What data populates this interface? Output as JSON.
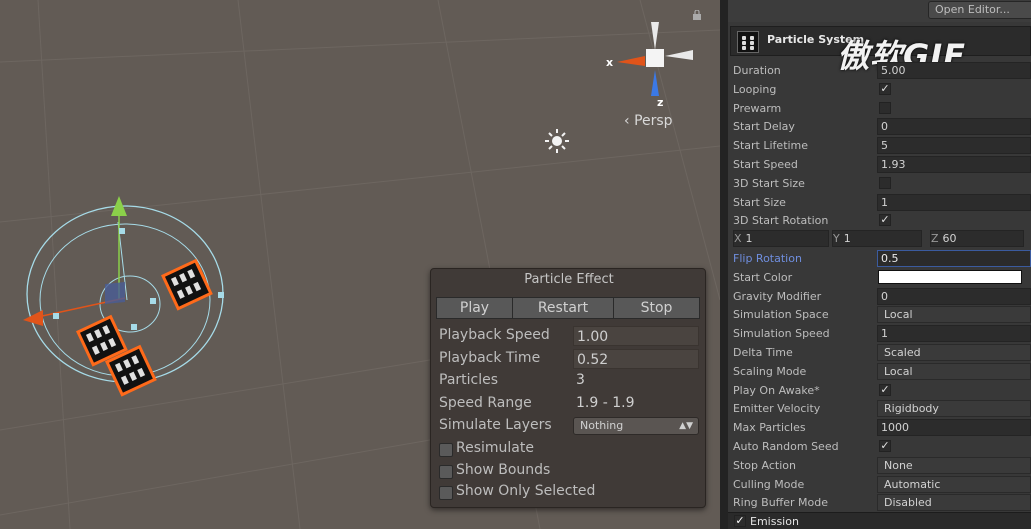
{
  "scene": {
    "gizmo": {
      "x_label": "x",
      "z_label": "z",
      "projection": "Persp"
    },
    "icons": [
      "lock-icon",
      "sun-icon",
      "move-gizmo",
      "particle-sprite"
    ]
  },
  "particle_effect": {
    "title": "Particle Effect",
    "buttons": {
      "play": "Play",
      "restart": "Restart",
      "stop": "Stop"
    },
    "playback_speed": {
      "label": "Playback Speed",
      "value": "1.00"
    },
    "playback_time": {
      "label": "Playback Time",
      "value": "0.52"
    },
    "particles": {
      "label": "Particles",
      "value": "3"
    },
    "speed_range": {
      "label": "Speed Range",
      "value": "1.9 - 1.9"
    },
    "simulate_layers": {
      "label": "Simulate Layers",
      "value": "Nothing"
    },
    "resimulate": "Resimulate",
    "show_bounds": "Show Bounds",
    "show_only_selected": "Show Only Selected"
  },
  "inspector": {
    "open_editor": "Open Editor...",
    "component_title": "Particle System",
    "watermark": "傲软GIF",
    "rows": [
      {
        "label": "Duration",
        "value": "5.00"
      },
      {
        "label": "Looping",
        "check": true
      },
      {
        "label": "Prewarm",
        "check": false
      },
      {
        "label": "Start Delay",
        "value": "0"
      },
      {
        "label": "Start Lifetime",
        "value": "5"
      },
      {
        "label": "Start Speed",
        "value": "1.93"
      },
      {
        "label": "3D Start Size",
        "check": false
      },
      {
        "label": "Start Size",
        "value": "1"
      },
      {
        "label": "3D Start Rotation",
        "check": true
      }
    ],
    "xyz": {
      "x": "1",
      "y": "1",
      "z": "60"
    },
    "rows2": [
      {
        "label": "Flip Rotation",
        "value": "0.5"
      },
      {
        "label": "Start Color"
      },
      {
        "label": "Gravity Modifier",
        "value": "0"
      },
      {
        "label": "Simulation Space",
        "value": "Local"
      },
      {
        "label": "Simulation Speed",
        "value": "1"
      },
      {
        "label": "Delta Time",
        "value": "Scaled"
      },
      {
        "label": "Scaling Mode",
        "value": "Local"
      },
      {
        "label": "Play On Awake*",
        "check": true
      },
      {
        "label": "Emitter Velocity",
        "value": "Rigidbody"
      },
      {
        "label": "Max Particles",
        "value": "1000"
      },
      {
        "label": "Auto Random Seed",
        "check": true
      },
      {
        "label": "Stop Action",
        "value": "None"
      },
      {
        "label": "Culling Mode",
        "value": "Automatic"
      },
      {
        "label": "Ring Buffer Mode",
        "value": "Disabled"
      }
    ],
    "emission": "Emission",
    "colors": {
      "start_color": "#ffffff",
      "highlight": "#6f8ede"
    }
  }
}
